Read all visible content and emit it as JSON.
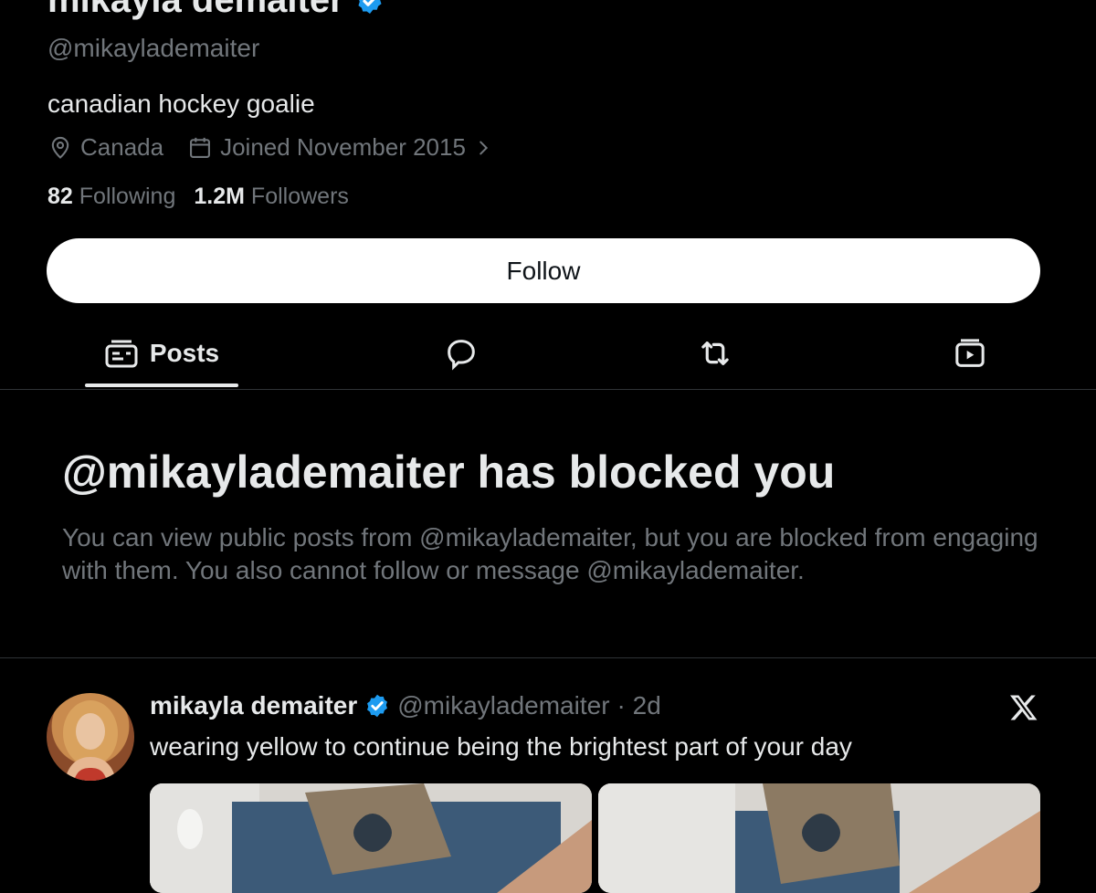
{
  "profile": {
    "display_name": "mikayla demaiter",
    "handle": "@mikaylademaiter",
    "bio": "canadian hockey goalie",
    "location": "Canada",
    "joined": "Joined November 2015",
    "following_count": "82",
    "following_label": "Following",
    "followers_count": "1.2M",
    "followers_label": "Followers"
  },
  "actions": {
    "follow_label": "Follow"
  },
  "tabs": [
    {
      "label": "Posts",
      "icon": "posts-icon",
      "active": true
    },
    {
      "label": "",
      "icon": "replies-icon"
    },
    {
      "label": "",
      "icon": "reposts-icon"
    },
    {
      "label": "",
      "icon": "media-icon"
    }
  ],
  "blocked": {
    "title": "@mikaylademaiter has blocked you",
    "description": "You can view public posts from @mikaylademaiter, but you are blocked from engaging with them. You also cannot follow or message @mikaylademaiter."
  },
  "post": {
    "author_name": "mikayla demaiter",
    "author_handle": "@mikaylademaiter",
    "time": "· 2d",
    "text": "wearing yellow to continue being the brightest part of your day"
  },
  "colors": {
    "background": "#000000",
    "text": "#e7e9ea",
    "muted": "#71767b",
    "verified": "#1d9bf0",
    "divider": "#2f3336"
  }
}
